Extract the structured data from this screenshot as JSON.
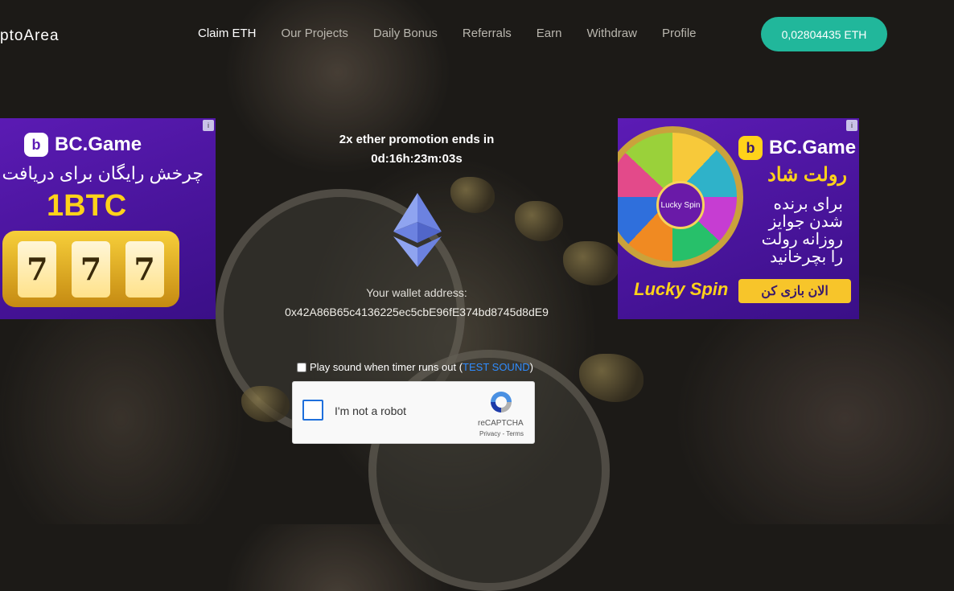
{
  "header": {
    "brand": "ptoArea",
    "nav": [
      {
        "label": "Claim ETH",
        "active": true
      },
      {
        "label": "Our Projects"
      },
      {
        "label": "Daily Bonus"
      },
      {
        "label": "Referrals"
      },
      {
        "label": "Earn"
      },
      {
        "label": "Withdraw"
      },
      {
        "label": "Profile"
      }
    ],
    "balance": "0,02804435 ETH",
    "balance_color": "#21b79b"
  },
  "ad_left": {
    "logo": "BC.Game",
    "line1": "چرخش رایگان برای دریافت",
    "big": "1BTC",
    "reels": [
      "7",
      "7",
      "7"
    ]
  },
  "ad_right": {
    "logo": "BC.Game",
    "title": "رولت شاد",
    "line1": "برای برنده",
    "line2": "شدن جوایز",
    "line3": "روزانه رولت",
    "line4": "را بچرخانید",
    "cta": "الان بازی کن",
    "wheel_center": "Lucky Spin",
    "lucky": "Lucky Spin"
  },
  "promo": {
    "line1": "2x ether promotion ends in",
    "line2": "0d:16h:23m:03s"
  },
  "wallet": {
    "label": "Your wallet address:",
    "address": "0x42A86B65c4136225ec5cbE96fE374bd8745d8dE9"
  },
  "sound": {
    "label": "Play sound when timer runs out (",
    "link": "TEST SOUND",
    "close": ")"
  },
  "captcha": {
    "label": "I'm not a robot",
    "brand": "reCAPTCHA",
    "links": "Privacy - Terms"
  }
}
